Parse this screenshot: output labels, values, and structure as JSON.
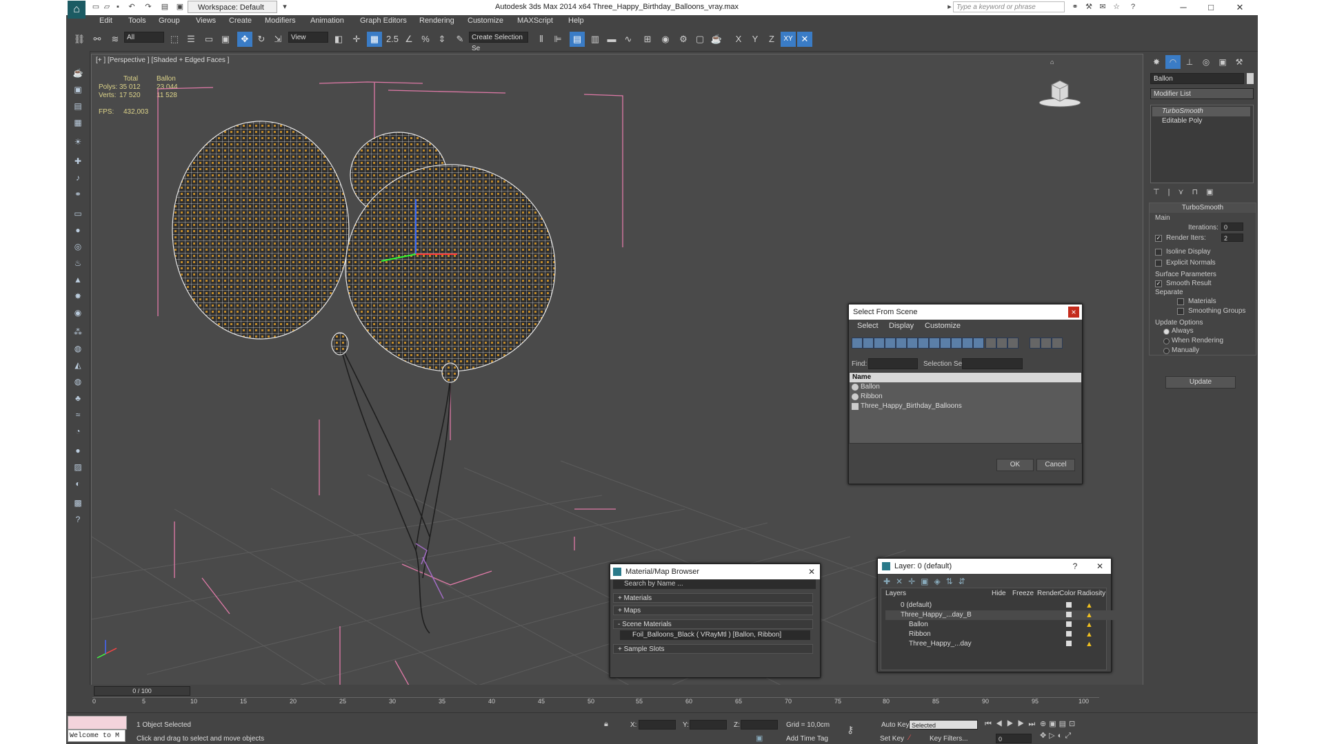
{
  "titlebar": {
    "workspace": "Workspace: Default",
    "title": "Autodesk 3ds Max  2014 x64     Three_Happy_Birthday_Balloons_vray.max",
    "search_placeholder": "Type a keyword or phrase"
  },
  "menu": [
    "Edit",
    "Tools",
    "Group",
    "Views",
    "Create",
    "Modifiers",
    "Animation",
    "Graph Editors",
    "Rendering",
    "Customize",
    "MAXScript",
    "Help"
  ],
  "toolbar": {
    "filter": "All",
    "ref_coord": "View",
    "selection_set": "Create Selection Se",
    "snap_label": "2.5",
    "axes": [
      "X",
      "Y",
      "Z",
      "XY"
    ]
  },
  "viewport": {
    "label": "[+ ] [Perspective ] [Shaded + Edged Faces ]",
    "stats": {
      "col_total": "Total",
      "col_obj": "Ballon",
      "polys_label": "Polys:",
      "polys_total": "35 012",
      "polys_obj": "23 044",
      "verts_label": "Verts:",
      "verts_total": "17 520",
      "verts_obj": "11 528",
      "fps_label": "FPS:",
      "fps": "432,003"
    }
  },
  "command_panel": {
    "object_name": "Ballon",
    "modifier_list": "Modifier List",
    "stack": [
      "TurboSmooth",
      "Editable Poly"
    ],
    "turbosmooth": {
      "title": "TurboSmooth",
      "main": "Main",
      "iterations_label": "Iterations:",
      "iterations": "0",
      "render_iters_label": "Render Iters:",
      "render_iters": "2",
      "isoline": "Isoline Display",
      "explicit": "Explicit Normals",
      "surface": "Surface Parameters",
      "smooth_result": "Smooth Result",
      "separate": "Separate",
      "materials": "Materials",
      "smoothing_groups": "Smoothing Groups",
      "update_options": "Update Options",
      "always": "Always",
      "when_rendering": "When Rendering",
      "manually": "Manually",
      "update_button": "Update"
    }
  },
  "select_from_scene": {
    "title": "Select From Scene",
    "menus": [
      "Select",
      "Display",
      "Customize"
    ],
    "find_label": "Find:",
    "selset_label": "Selection Set:",
    "column_name": "Name",
    "rows": [
      "Ballon",
      "Ribbon",
      "Three_Happy_Birthday_Balloons"
    ],
    "ok": "OK",
    "cancel": "Cancel"
  },
  "material_browser": {
    "title": "Material/Map Browser",
    "search": "Search by Name ...",
    "sections": [
      "+ Materials",
      "+ Maps",
      "- Scene Materials",
      "+ Sample Slots"
    ],
    "scene_item": "Foil_Balloons_Black  ( VRayMtl ) [Ballon, Ribbon]"
  },
  "layer_dialog": {
    "title": "Layer: 0 (default)",
    "headers": [
      "Layers",
      "Hide",
      "Freeze",
      "Render",
      "Color",
      "Radiosity"
    ],
    "rows": [
      "0 (default)",
      "Three_Happy_...day_B",
      "Ballon",
      "Ribbon",
      "Three_Happy_...day"
    ]
  },
  "timeline": {
    "slider": "0 / 100",
    "ticks": [
      "0",
      "5",
      "10",
      "15",
      "20",
      "25",
      "30",
      "35",
      "40",
      "45",
      "50",
      "55",
      "60",
      "65",
      "70",
      "75",
      "80",
      "85",
      "90",
      "95",
      "100"
    ]
  },
  "status": {
    "maxscript": "Welcome to M",
    "selected": "1 Object Selected",
    "prompt": "Click and drag to select and move objects",
    "x_label": "X:",
    "y_label": "Y:",
    "z_label": "Z:",
    "grid": "Grid = 10,0cm",
    "add_time_tag": "Add Time Tag",
    "auto_key": "Auto Key",
    "set_key": "Set Key",
    "key_mode": "Selected",
    "key_filters": "Key Filters...",
    "frame": "0"
  },
  "colors": {
    "accent": "#3a7cc6",
    "viewport_bg": "#4a4a4a",
    "grid_line": "#5a5a5a",
    "pink_helper": "#e07aa8",
    "stats_text": "#ddd48a"
  }
}
